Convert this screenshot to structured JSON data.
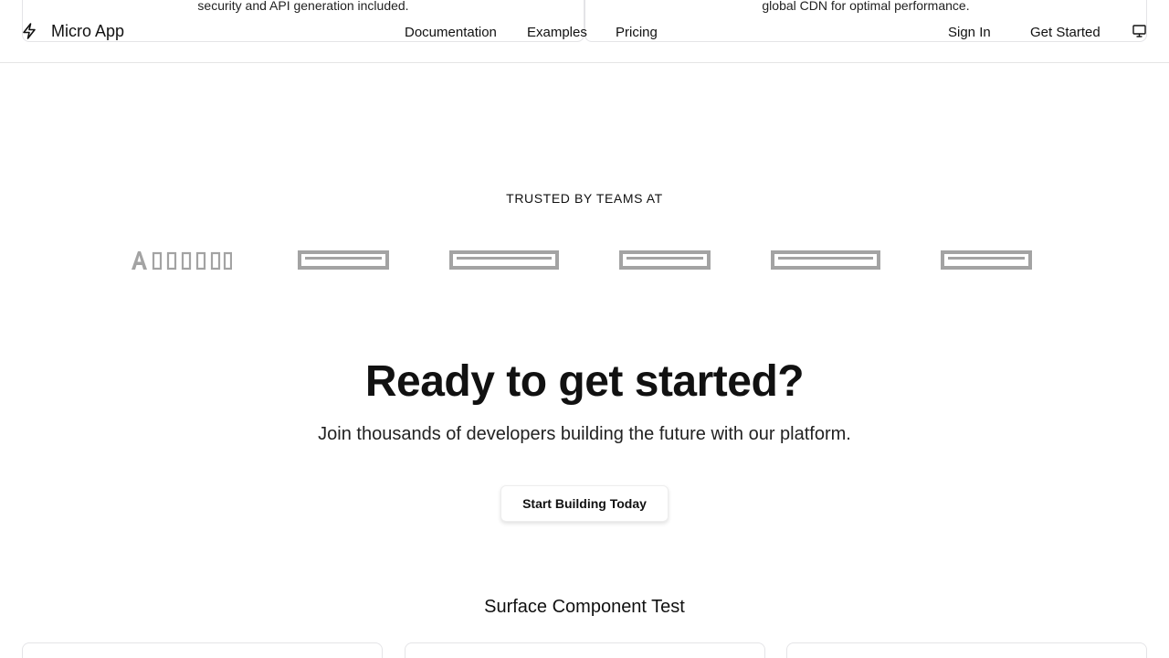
{
  "peek_cards": {
    "left_text": "security and API generation included.",
    "right_text": "global CDN for optimal performance."
  },
  "header": {
    "brand": "Micro App",
    "nav": [
      "Documentation",
      "Examples",
      "Pricing"
    ],
    "sign_in": "Sign In",
    "get_started": "Get Started"
  },
  "icons": {
    "logo": "bolt-icon",
    "theme": "monitor-icon"
  },
  "trusted": {
    "heading": "TRUSTED BY TEAMS AT"
  },
  "cta": {
    "title": "Ready to get started?",
    "subtitle": "Join thousands of developers building the future with our platform.",
    "button": "Start Building Today"
  },
  "surface": {
    "title": "Surface Component Test"
  },
  "colors": {
    "logo_gray": "#a3a3a3",
    "border": "#e5e5e5"
  }
}
